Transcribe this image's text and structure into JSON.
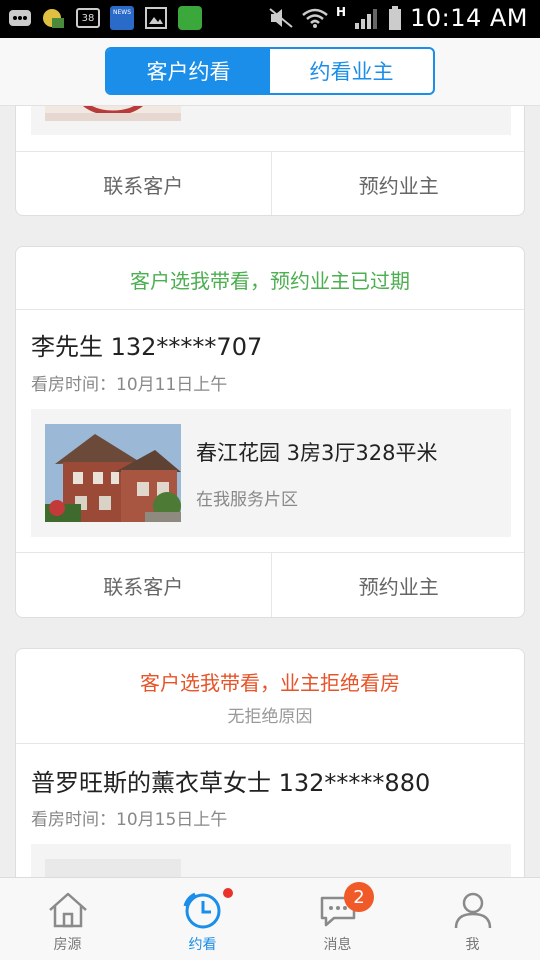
{
  "status_bar": {
    "time": "10:14 AM",
    "notif_badge": "38",
    "news_label": "NEWS",
    "network": "H"
  },
  "header": {
    "tabs": [
      {
        "label": "客户约看",
        "active": true
      },
      {
        "label": "约看业主",
        "active": false
      }
    ]
  },
  "cards": [
    {
      "actions": [
        "联系客户",
        "预约业主"
      ]
    },
    {
      "status": "客户选我带看，预约业主已过期",
      "status_color": "#4caf50",
      "customer": "李先生  132*****707",
      "viewing_time": "看房时间：10月11日上午",
      "house_title": "春江花园  3房3厅328平米",
      "house_sub": "在我服务片区",
      "actions": [
        "联系客户",
        "预约业主"
      ]
    },
    {
      "status": "客户选我带看，业主拒绝看房",
      "status_color": "#e8542a",
      "reason": "无拒绝原因",
      "customer": "普罗旺斯的薰衣草女士  132*****880",
      "viewing_time": "看房时间：10月15日上午"
    }
  ],
  "tabbar": {
    "items": [
      {
        "label": "房源",
        "icon": "house-icon"
      },
      {
        "label": "约看",
        "icon": "clock-icon",
        "active": true
      },
      {
        "label": "消息",
        "icon": "chat-icon",
        "badge": "2"
      },
      {
        "label": "我",
        "icon": "person-icon"
      }
    ]
  },
  "colors": {
    "accent": "#1a8ee8",
    "green": "#4caf50",
    "orange": "#e8542a",
    "badge": "#f05a28"
  }
}
